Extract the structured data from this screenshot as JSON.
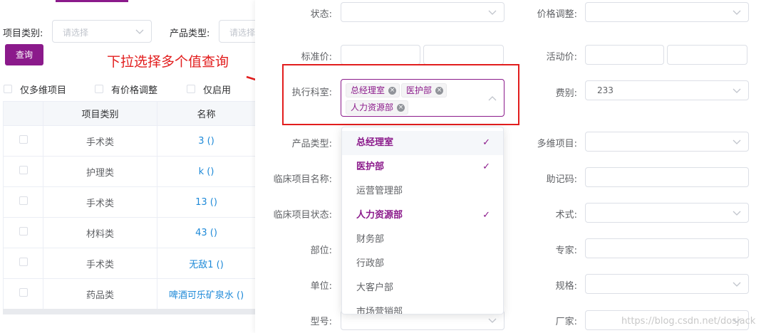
{
  "left": {
    "filters": {
      "project_category_label": "项目类别:",
      "project_category_placeholder": "请选择",
      "product_type_label": "产品类型:",
      "product_type_placeholder": "请选择"
    },
    "query_button": "查询",
    "checkboxes": [
      "仅多维项目",
      "有价格调整",
      "仅启用"
    ],
    "table": {
      "headers": [
        "",
        "项目类别",
        "名称"
      ],
      "rows": [
        {
          "category": "手术类",
          "name": "3 ()"
        },
        {
          "category": "护理类",
          "name": "k ()"
        },
        {
          "category": "手术类",
          "name": "13 ()"
        },
        {
          "category": "材料类",
          "name": "43 ()"
        },
        {
          "category": "手术类",
          "name": "无敌1 ()"
        },
        {
          "category": "药品类",
          "name": "啤酒可乐矿泉水 ()"
        }
      ]
    }
  },
  "annotation": {
    "text": "下拉选择多个值查询"
  },
  "form": {
    "status_label": "状态:",
    "price_adjust_label": "价格调整:",
    "std_price_label": "标准价:",
    "promo_price_label": "活动价:",
    "exec_dept_label": "执行科室:",
    "exec_dept_tags": [
      "总经理室",
      "医护部",
      "人力资源部"
    ],
    "fee_type_label": "费别:",
    "fee_type_value": "233",
    "product_type_label": "产品类型:",
    "multi_dim_label": "多维项目:",
    "clinical_name_label": "临床项目名称:",
    "mnemonic_label": "助记码:",
    "clinical_status_label": "临床项目状态:",
    "technique_label": "术式:",
    "part_label": "部位:",
    "expert_label": "专家:",
    "unit_label": "单位:",
    "spec_label": "规格:",
    "model_label": "型号:",
    "manufacturer_label": "厂家:"
  },
  "dropdown": {
    "options": [
      {
        "label": "总经理室",
        "selected": true,
        "hover": true
      },
      {
        "label": "医护部",
        "selected": true
      },
      {
        "label": "运营管理部",
        "selected": false
      },
      {
        "label": "人力资源部",
        "selected": true
      },
      {
        "label": "财务部",
        "selected": false
      },
      {
        "label": "行政部",
        "selected": false
      },
      {
        "label": "大客户部",
        "selected": false
      },
      {
        "label": "市场营销部",
        "selected": false
      }
    ],
    "check_glyph": "✓"
  },
  "watermark": "https://blog.csdn.net/dosjack",
  "colors": {
    "accent": "#8b1a8b",
    "annotation": "#e21d1d",
    "link": "#1f8ad8"
  }
}
